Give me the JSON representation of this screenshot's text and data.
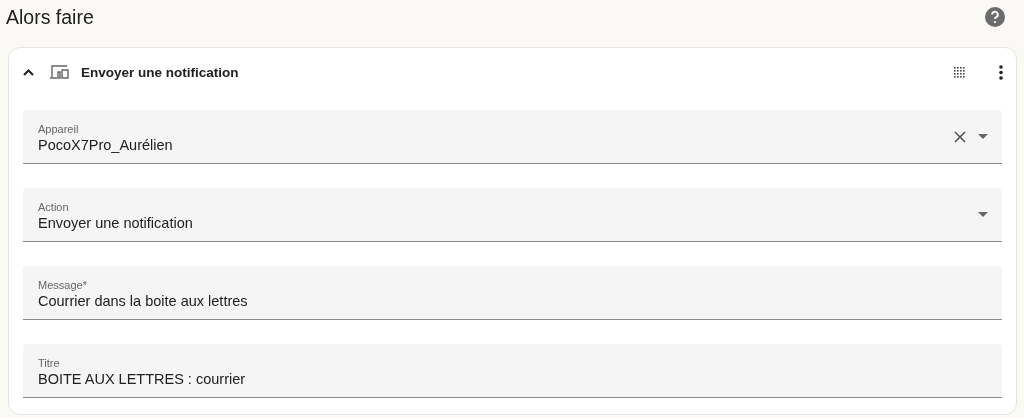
{
  "section": {
    "title": "Alors faire"
  },
  "action_card": {
    "title": "Envoyer une notification",
    "expanded": true,
    "fields": [
      {
        "kind": "select",
        "label": "Appareil",
        "value": "PocoX7Pro_Aurélien",
        "clearable": true
      },
      {
        "kind": "select",
        "label": "Action",
        "value": "Envoyer une notification",
        "clearable": false
      },
      {
        "kind": "text",
        "label": "Message*",
        "value": "Courrier dans la boite aux lettres"
      },
      {
        "kind": "text",
        "label": "Titre",
        "value": "BOITE AUX LETTRES : courrier"
      }
    ]
  }
}
